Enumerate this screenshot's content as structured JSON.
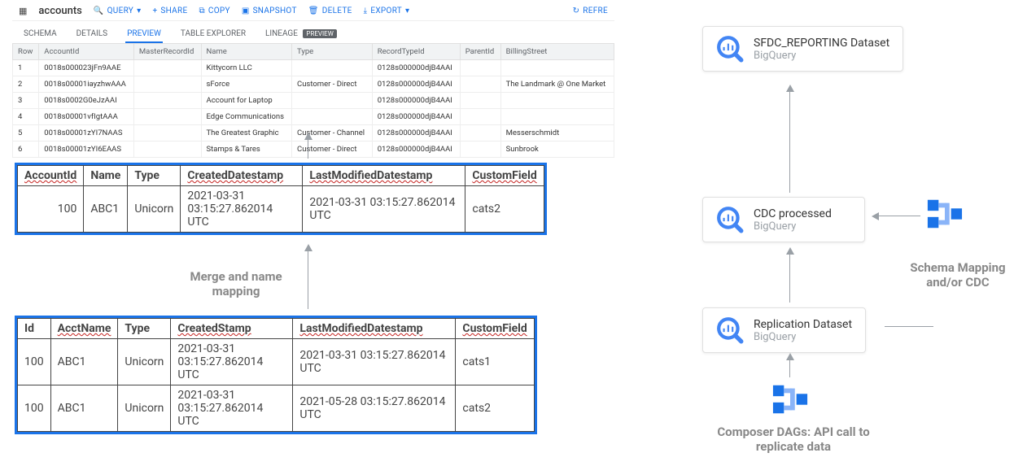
{
  "bq": {
    "title": "accounts",
    "actions": {
      "query": "QUERY",
      "share": "SHARE",
      "copy": "COPY",
      "snapshot": "SNAPSHOT",
      "delete": "DELETE",
      "export": "EXPORT",
      "refresh": "REFRE"
    },
    "tabs": {
      "schema": "SCHEMA",
      "details": "DETAILS",
      "preview": "PREVIEW",
      "explorer": "TABLE EXPLORER",
      "lineage": "LINEAGE",
      "lineage_badge": "PREVIEW"
    },
    "cols": {
      "row": "Row",
      "accountid": "AccountId",
      "masterrecordid": "MasterRecordId",
      "name": "Name",
      "type": "Type",
      "recordtypeid": "RecordTypeId",
      "parentid": "ParentId",
      "billingstreet": "BillingStreet"
    },
    "rows": [
      {
        "n": "1",
        "accountid": "0018s000023jFn9AAE",
        "master": "",
        "name": "Kittycorn LLC",
        "type": "",
        "rtid": "0128s000000djB4AAI",
        "parent": "",
        "billing": ""
      },
      {
        "n": "2",
        "accountid": "0018s00001iayzhwAAA",
        "master": "",
        "name": "sForce",
        "type": "Customer - Direct",
        "rtid": "0128s000000djB4AAI",
        "parent": "",
        "billing": "The Landmark @ One Market"
      },
      {
        "n": "3",
        "accountid": "0018s0002G0eJzAAI",
        "master": "",
        "name": "Account for Laptop",
        "type": "",
        "rtid": "0128s000000djB4AAI",
        "parent": "",
        "billing": ""
      },
      {
        "n": "4",
        "accountid": "0018s00001vfIgtAAA",
        "master": "",
        "name": "Edge Communications",
        "type": "",
        "rtid": "0128s000000djB4AAI",
        "parent": "",
        "billing": ""
      },
      {
        "n": "5",
        "accountid": "0018s00001zYI7NAAS",
        "master": "",
        "name": "The Greatest Graphic",
        "type": "Customer - Channel",
        "rtid": "0128s000000djB4AAI",
        "parent": "",
        "billing": "Messerschmidt"
      },
      {
        "n": "6",
        "accountid": "0018s00001zYI6EAAS",
        "master": "",
        "name": "Stamps & Tares",
        "type": "Customer - Direct",
        "rtid": "0128s000000djB4AAI",
        "parent": "",
        "billing": "Sunbrook"
      }
    ]
  },
  "upper": {
    "headers": {
      "accountid": "AccountId",
      "name": "Name",
      "type": "Type",
      "created": "CreatedDatestamp",
      "modified": "LastModifiedDatestamp",
      "custom": "CustomField"
    },
    "row": {
      "accountid": "100",
      "name": "ABC1",
      "type": "Unicorn",
      "created": "2021-03-31 03:15:27.862014 UTC",
      "modified": "2021-03-31 03:15:27.862014 UTC",
      "custom": "cats2"
    }
  },
  "lower": {
    "headers": {
      "id": "Id",
      "acctname": "AcctName",
      "type": "Type",
      "created": "CreatedStamp",
      "modified": "LastModifiedDatestamp",
      "custom": "CustomField"
    },
    "rows": [
      {
        "id": "100",
        "acctname": "ABC1",
        "type": "Unicorn",
        "created": "2021-03-31 03:15:27.862014 UTC",
        "modified": "2021-03-31 03:15:27.862014 UTC",
        "custom": "cats1"
      },
      {
        "id": "100",
        "acctname": "ABC1",
        "type": "Unicorn",
        "created": "2021-03-31 03:15:27.862014 UTC",
        "modified": "2021-05-28 03:15:27.862014 UTC",
        "custom": "cats2"
      }
    ]
  },
  "labels": {
    "merge": "Merge and name mapping",
    "schema_cdc": "Schema Mapping and/or CDC",
    "composer": "Composer DAGs: API call to replicate data"
  },
  "cards": {
    "sfdc": {
      "title": "SFDC_REPORTING Dataset",
      "sub": "BigQuery"
    },
    "cdc": {
      "title": "CDC processed",
      "sub": "BigQuery"
    },
    "rep": {
      "title": "Replication Dataset",
      "sub": "BigQuery"
    }
  }
}
